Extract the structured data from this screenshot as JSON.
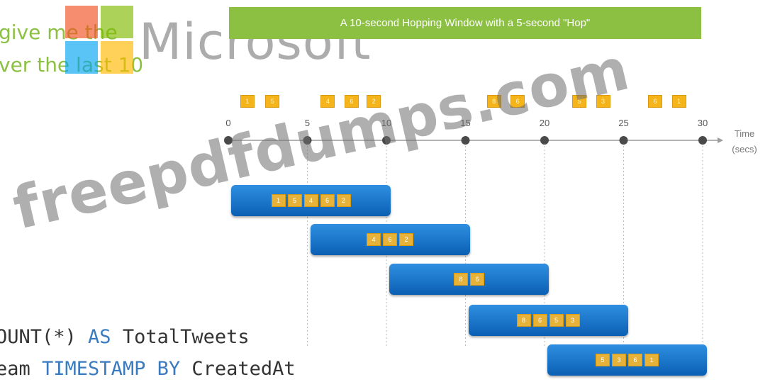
{
  "partial_text": {
    "line1": "give me the",
    "line2": "ver the last 10"
  },
  "logo": {
    "wordmark": "Microsoft",
    "colors": [
      "#f25022",
      "#7fba00",
      "#00a4ef",
      "#ffb900"
    ]
  },
  "title": "A 10-second Hopping Window with a 5-second \"Hop\"",
  "axis": {
    "ticks": [
      "0",
      "5",
      "10",
      "15",
      "20",
      "25",
      "30"
    ],
    "label_line1": "Time",
    "label_line2": "(secs)"
  },
  "events": [
    {
      "t": 1.2,
      "label": "1"
    },
    {
      "t": 2.8,
      "label": "5"
    },
    {
      "t": 6.3,
      "label": "4"
    },
    {
      "t": 7.8,
      "label": "6"
    },
    {
      "t": 9.2,
      "label": "2"
    },
    {
      "t": 16.8,
      "label": "8"
    },
    {
      "t": 18.3,
      "label": "6"
    },
    {
      "t": 22.2,
      "label": "5"
    },
    {
      "t": 23.7,
      "label": "3"
    },
    {
      "t": 27.0,
      "label": "6"
    },
    {
      "t": 28.5,
      "label": "1"
    }
  ],
  "windows": [
    {
      "start": 0,
      "end": 10,
      "chips": [
        "1",
        "5",
        "4",
        "6",
        "2"
      ]
    },
    {
      "start": 5,
      "end": 15,
      "chips": [
        "4",
        "6",
        "2"
      ]
    },
    {
      "start": 10,
      "end": 20,
      "chips": [
        "8",
        "6"
      ]
    },
    {
      "start": 15,
      "end": 25,
      "chips": [
        "8",
        "6",
        "5",
        "3"
      ]
    },
    {
      "start": 20,
      "end": 30,
      "chips": [
        "5",
        "3",
        "6",
        "1"
      ]
    }
  ],
  "watermark": "freepdfdumps.com",
  "code": {
    "line1_prefix": "OUNT(*) ",
    "line1_kw": "AS",
    "line1_rest": " TotalTweets",
    "line2_prefix": "eam ",
    "line2_kw": "TIMESTAMP BY",
    "line2_rest": " CreatedAt"
  },
  "colors": {
    "banner": "#8cc043",
    "chip": "#f4b41a",
    "window": "#1570c9",
    "keyword": "#3a7bbf"
  }
}
